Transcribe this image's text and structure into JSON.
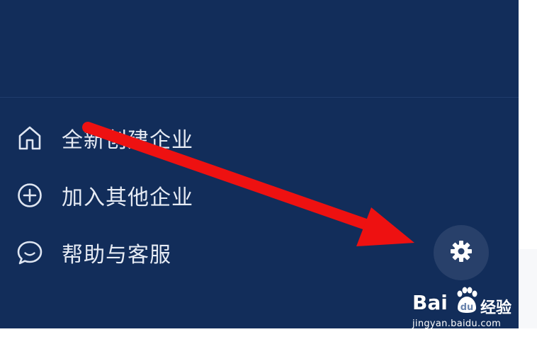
{
  "drawer": {
    "background": "#122d5a",
    "menu": [
      {
        "label": "全新创建企业",
        "icon": "home-icon"
      },
      {
        "label": "加入其他企业",
        "icon": "plus-circle-icon"
      },
      {
        "label": "帮助与客服",
        "icon": "chat-bubble-icon"
      }
    ],
    "settings_icon": "gear-icon"
  },
  "annotation": {
    "color": "#ee1111",
    "icon": "red-arrow"
  },
  "watermark": {
    "logo": "Bai",
    "logo_du": "du",
    "brand": "经验",
    "url": "jingyan.baidu.com"
  }
}
